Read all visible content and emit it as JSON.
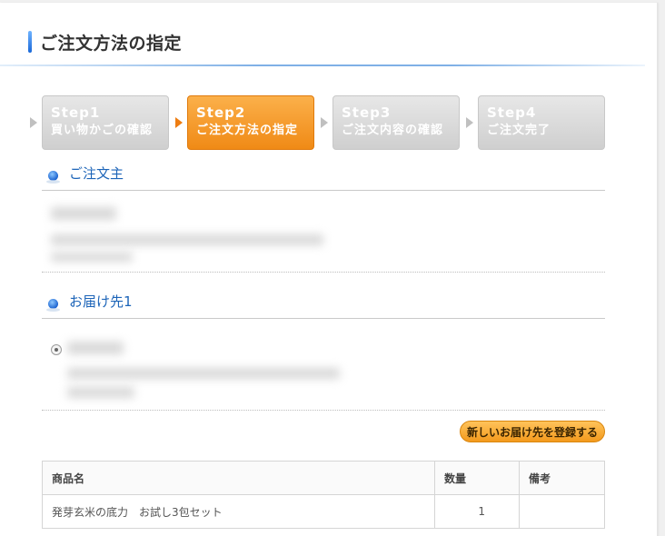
{
  "page": {
    "title": "ご注文方法の指定"
  },
  "steps": [
    {
      "num": "Step1",
      "label": "買い物かごの確認",
      "active": false
    },
    {
      "num": "Step2",
      "label": "ご注文方法の指定",
      "active": true
    },
    {
      "num": "Step3",
      "label": "ご注文内容の確認",
      "active": false
    },
    {
      "num": "Step4",
      "label": "ご注文完了",
      "active": false
    }
  ],
  "orderer": {
    "heading": "ご注文主"
  },
  "delivery": {
    "heading": "お届け先1"
  },
  "buttons": {
    "new_address": "新しいお届け先を登録する"
  },
  "table": {
    "headers": {
      "name": "商品名",
      "qty": "数量",
      "note": "備考"
    },
    "rows": [
      {
        "name": "発芽玄米の底力　お試し3包セット",
        "qty": "1",
        "note": ""
      }
    ]
  },
  "colors": {
    "accent": "#f08a16",
    "heading": "#1c64b8"
  }
}
